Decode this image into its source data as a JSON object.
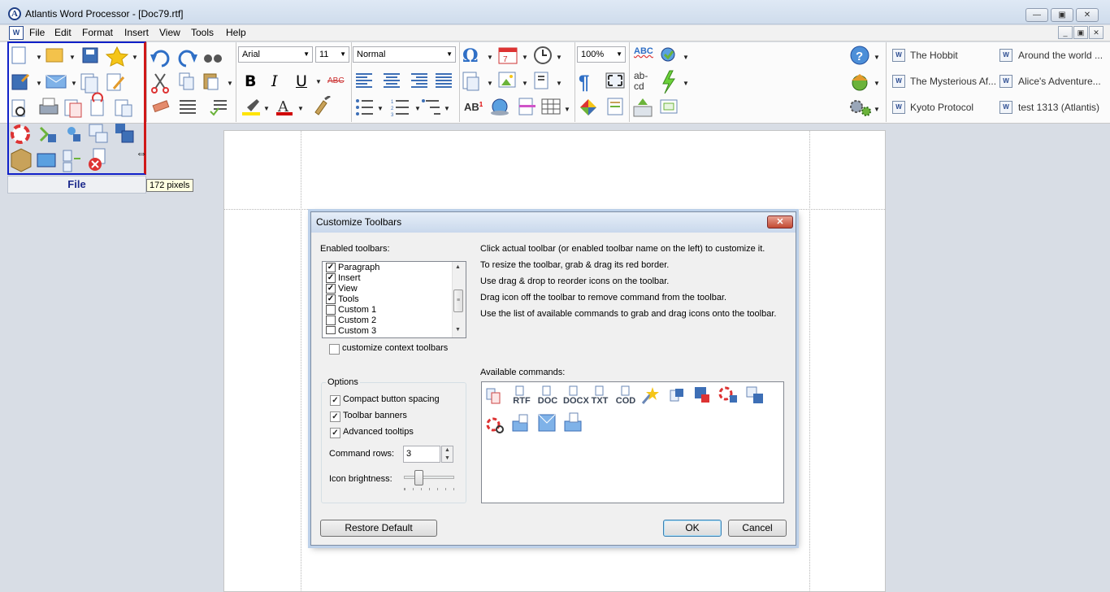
{
  "window": {
    "title": "Atlantis Word Processor - [Doc79.rtf]",
    "app_logo": "A"
  },
  "menu": [
    "File",
    "Edit",
    "Format",
    "Insert",
    "View",
    "Tools",
    "Help"
  ],
  "toolbar": {
    "font": "Arial",
    "size": "11",
    "style": "Normal",
    "zoom": "100%",
    "bold": "B",
    "italic": "I",
    "underline": "U",
    "strike": "ABC",
    "abc_label": "ABC",
    "abcd_label": "ab-\ncd",
    "ab1_label": "AB",
    "file_banner": "File",
    "pixels_tip": "172 pixels"
  },
  "recent_docs": [
    "The Hobbit",
    "Around the world ...",
    "The Mysterious Af...",
    "Alice's Adventure...",
    "Kyoto Protocol",
    "test 1313 (Atlantis)"
  ],
  "dialog": {
    "title": "Customize Toolbars",
    "enabled_label": "Enabled toolbars:",
    "toolbars": [
      {
        "name": "Paragraph",
        "checked": true
      },
      {
        "name": "Insert",
        "checked": true
      },
      {
        "name": "View",
        "checked": true
      },
      {
        "name": "Tools",
        "checked": true
      },
      {
        "name": "Custom 1",
        "checked": false
      },
      {
        "name": "Custom 2",
        "checked": false
      },
      {
        "name": "Custom 3",
        "checked": false
      }
    ],
    "context_label": "customize context toolbars",
    "instructions": [
      "Click actual toolbar (or enabled toolbar name on the left) to customize it.",
      "To resize the toolbar, grab & drag its red border.",
      "Use drag & drop to reorder icons on the toolbar.",
      "Drag icon off the toolbar to remove command from the toolbar.",
      "Use the list of available commands to grab and drag icons onto the toolbar."
    ],
    "options_label": "Options",
    "compact": "Compact button spacing",
    "banners": "Toolbar banners",
    "advanced": "Advanced tooltips",
    "rows_label": "Command rows:",
    "rows_value": "3",
    "brightness_label": "Icon brightness:",
    "brightness_level": 0.25,
    "available_label": "Available commands:",
    "command_labels": [
      "RTF",
      "DOC",
      "DOCX",
      "TXT",
      "COD"
    ],
    "restore": "Restore Default",
    "ok": "OK",
    "cancel": "Cancel"
  },
  "colors": {
    "accent": "#1f4e9e",
    "file_border": "#1020c8",
    "resize_border": "#d01818"
  }
}
